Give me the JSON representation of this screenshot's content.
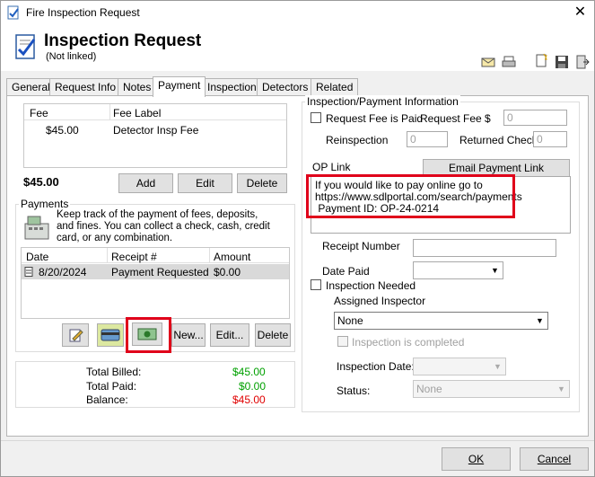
{
  "window": {
    "title": "Fire Inspection Request",
    "close": "✕"
  },
  "header": {
    "title": "Inspection Request",
    "subtitle": "(Not linked)"
  },
  "tabs": [
    "General",
    "Request Info",
    "Notes",
    "Payment",
    "Inspection",
    "Detectors",
    "Related"
  ],
  "fees": {
    "columns": [
      "Fee",
      "Fee Label"
    ],
    "rows": [
      {
        "fee": "$45.00",
        "label": "Detector Insp Fee"
      }
    ],
    "total": "$45.00",
    "buttons": {
      "add": "Add",
      "edit": "Edit",
      "delete": "Delete"
    }
  },
  "payments": {
    "group_label": "Payments",
    "description": "Keep track of the payment of fees, deposits, and fines. You can collect a check, cash, credit card, or any combination.",
    "columns": [
      "Date",
      "Receipt #",
      "Amount"
    ],
    "rows": [
      {
        "date": "8/20/2024",
        "receipt": "Payment Requested",
        "amount": "$0.00"
      }
    ],
    "buttons": {
      "new": "New...",
      "edit": "Edit...",
      "delete": "Delete"
    }
  },
  "totals": {
    "billed_label": "Total Billed:",
    "billed": "$45.00",
    "paid_label": "Total Paid:",
    "paid": "$0.00",
    "balance_label": "Balance:",
    "balance": "$45.00",
    "colors": {
      "billed": "#00a000",
      "paid": "#00a000",
      "balance": "#e00000"
    }
  },
  "info": {
    "group_label": "Inspection/Payment Information",
    "request_fee_paid": "Request Fee is Paid",
    "request_fee_label": "Request Fee $",
    "request_fee_value": "0",
    "reinspection_label": "Reinspection",
    "reinspection_value": "0",
    "returned_check_label": "Returned Check",
    "returned_check_value": "0",
    "op_link_label": "OP Link",
    "email_payment_link": "Email Payment Link",
    "op_link_text": {
      "line1": "If you would like to pay online go to",
      "line2": "https://www.sdlportal.com/search/payments",
      "line3": " Payment ID: OP-24-0214"
    },
    "receipt_number_label": "Receipt Number",
    "date_paid_label": "Date Paid",
    "inspection_needed": "Inspection Needed",
    "assigned_inspector_label": "Assigned Inspector",
    "assigned_inspector_value": "None",
    "inspection_completed": "Inspection is completed",
    "inspection_date_label": "Inspection Date:",
    "status_label": "Status:",
    "status_value": "None"
  },
  "footer": {
    "ok": "OK",
    "cancel": "Cancel"
  }
}
